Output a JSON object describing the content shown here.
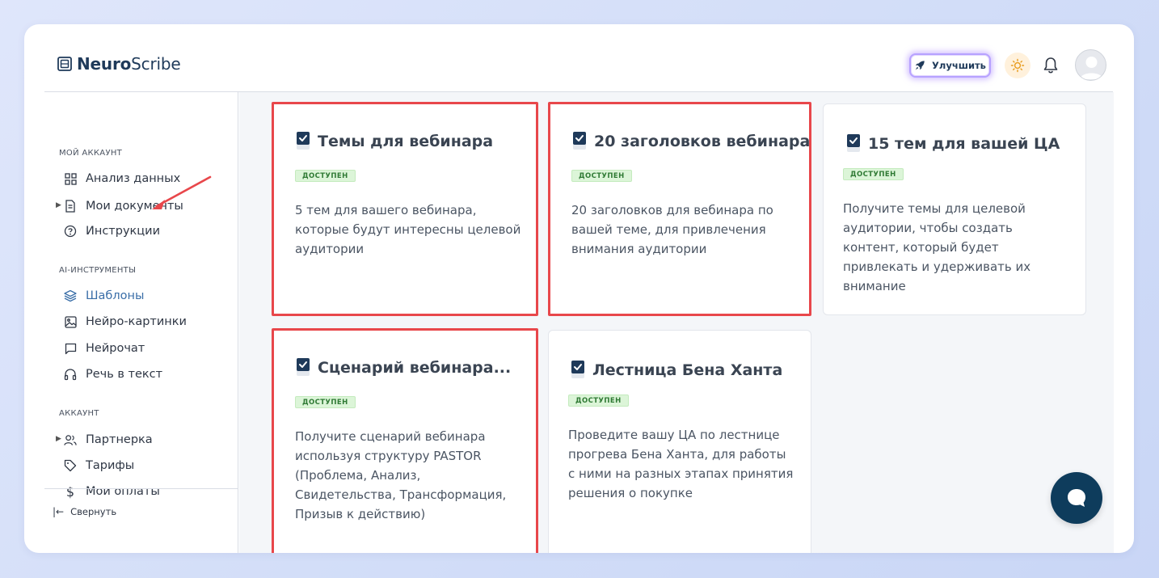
{
  "brand": {
    "bold": "Neuro",
    "thin": "Scribe"
  },
  "header": {
    "upgrade_label": "Улучшить",
    "upgrade_icon": "rocket-icon",
    "theme_icon": "sun-icon",
    "notifications_icon": "bell-icon",
    "accent_glow": "#b7a2ff"
  },
  "sidebar": {
    "sections": [
      {
        "label": "МОЙ АККАУНТ"
      },
      {
        "label": "AI-ИНСТРУМЕНТЫ"
      },
      {
        "label": "АККАУНТ"
      }
    ],
    "items": [
      {
        "label": "Анализ данных",
        "icon": "grid-icon"
      },
      {
        "label": "Мои документы",
        "icon": "document-icon",
        "has_caret": true
      },
      {
        "label": "Инструкции",
        "icon": "help-circle-icon"
      },
      {
        "label": "Шаблоны",
        "icon": "layers-icon",
        "active": true
      },
      {
        "label": "Нейро-картинки",
        "icon": "image-icon"
      },
      {
        "label": "Нейрочат",
        "icon": "chat-bubble-icon"
      },
      {
        "label": "Речь в текст",
        "icon": "headphones-icon"
      },
      {
        "label": "Партнерка",
        "icon": "users-icon",
        "has_caret": true
      },
      {
        "label": "Тарифы",
        "icon": "tag-icon"
      },
      {
        "label": "Мои оплаты",
        "icon": "dollar-icon"
      }
    ],
    "collapse_label": "Свернуть"
  },
  "cards": [
    {
      "title": "Темы для вебинара",
      "badge": "ДОСТУПЕН",
      "description": "5 тем для вашего вебинара, которые будут интересны целевой аудитории",
      "highlighted": true
    },
    {
      "title": "20 заголовков вебинара",
      "badge": "ДОСТУПЕН",
      "description": "20 заголовков для вебинара по вашей теме, для привлечения внимания аудитории",
      "highlighted": true
    },
    {
      "title": "15 тем для вашей ЦА",
      "badge": "ДОСТУПЕН",
      "description": "Получите темы для целевой аудитории, чтобы создать контент, который будет привлекать и удерживать их внимание",
      "highlighted": false
    },
    {
      "title": "Сценарий вебинара...",
      "badge": "ДОСТУПЕН",
      "description": "Получите сценарий вебинара используя структуру PASTOR (Проблема, Анализ, Свидетельства, Трансформация, Призыв к действию)",
      "highlighted": true
    },
    {
      "title": "Лестница Бена Ханта",
      "badge": "ДОСТУПЕН",
      "description": "Проведите вашу ЦА по лестнице прогрева Бена Ханта, для работы с ними на разных этапах принятия решения о покупке",
      "highlighted": false
    }
  ],
  "colors": {
    "highlight_border": "#e8474b",
    "badge_bg": "#dcf5d8",
    "badge_text": "#2f7a34",
    "chat_fab": "#0e3c5c",
    "active_nav": "#3a6ea8"
  }
}
